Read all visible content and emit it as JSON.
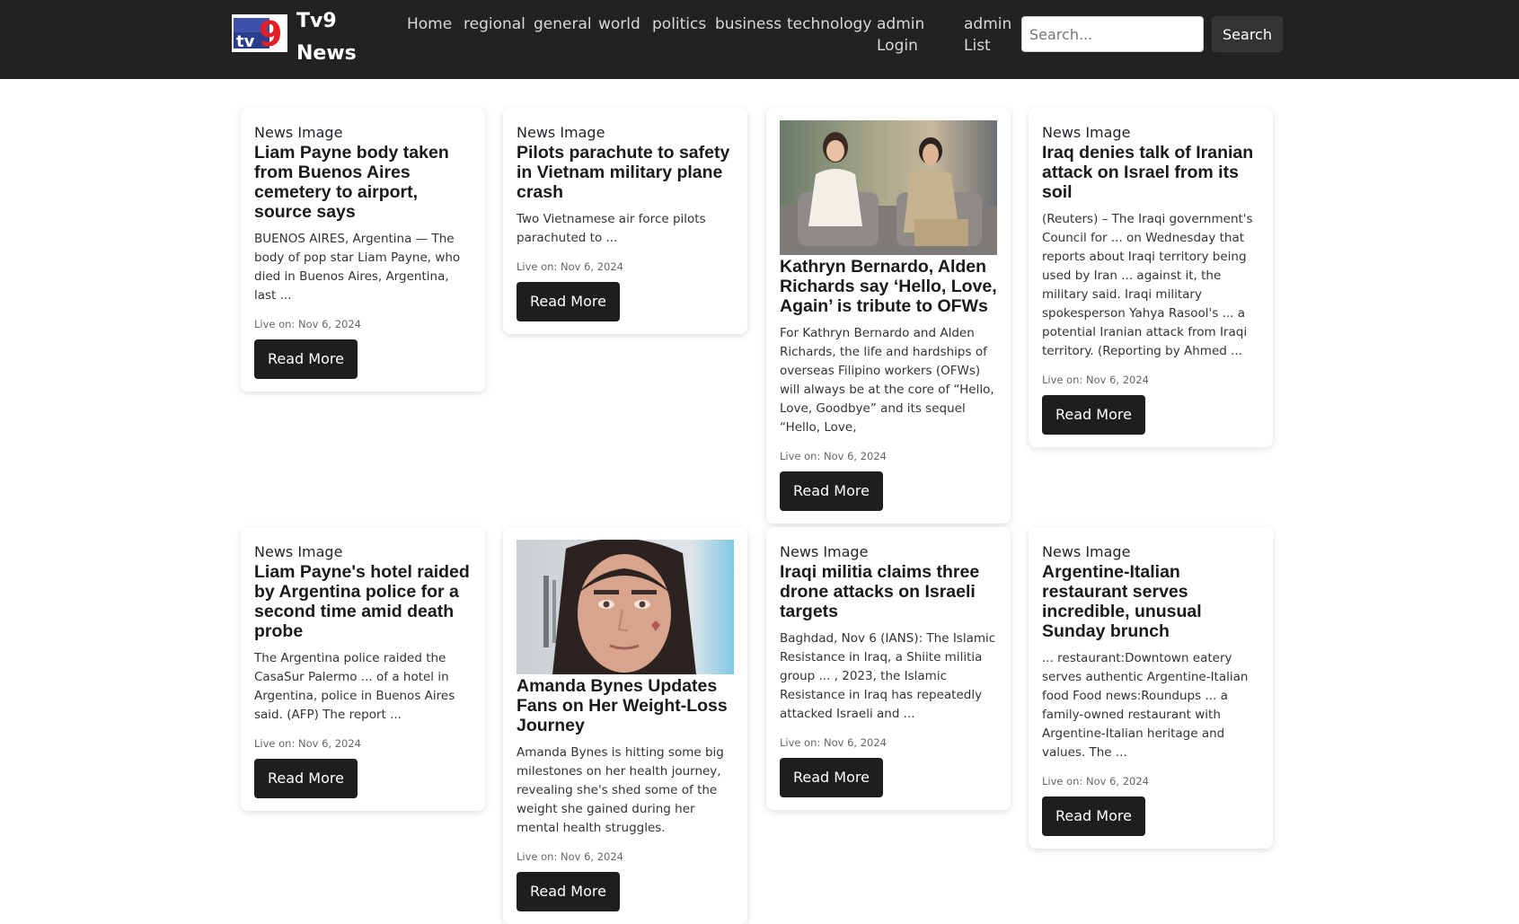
{
  "header": {
    "brand_name": "Tv9 News",
    "nav": [
      "Home",
      "regional",
      "general",
      "world",
      "politics",
      "business",
      "technology",
      "admin Login",
      "admin List"
    ],
    "search_placeholder": "Search...",
    "search_button": "Search"
  },
  "cards": [
    {
      "image_alt": "News Image",
      "title": "Liam Payne body taken from Buenos Aires cemetery to airport, source says",
      "text": "BUENOS AIRES, Argentina — The body of pop star Liam Payne, who died in Buenos Aires, Argentina, last ...",
      "date": "Live on: Nov 6, 2024",
      "button": "Read More"
    },
    {
      "image_alt": "News Image",
      "title": "Pilots parachute to safety in Vietnam military plane crash",
      "text": "Two Vietnamese air force pilots parachuted to ...",
      "date": "Live on: Nov 6, 2024",
      "button": "Read More"
    },
    {
      "image_alt": "",
      "title": "Kathryn Bernardo, Alden Richards say ‘Hello, Love, Again’ is tribute to OFWs",
      "text": "For Kathryn Bernardo and Alden Richards, the life and hardships of overseas Filipino workers (OFWs) will always be at the core of “Hello, Love, Goodbye” and its sequel “Hello, Love,",
      "date": "Live on: Nov 6, 2024",
      "button": "Read More"
    },
    {
      "image_alt": "News Image",
      "title": "Iraq denies talk of Iranian attack on Israel from its soil",
      "text": "(Reuters) – The Iraqi government's Council for ... on Wednesday that reports about Iraqi territory being used by Iran ... against it, the military said. Iraqi military spokesperson Yahya Rasool's ... a potential Iranian attack from Iraqi territory. (Reporting by Ahmed ...",
      "date": "Live on: Nov 6, 2024",
      "button": "Read More"
    },
    {
      "image_alt": "News Image",
      "title": "Liam Payne's hotel raided by Argentina police for a second time amid death probe",
      "text": "The Argentina police raided the CasaSur Palermo ... of a hotel in Argentina, police in Buenos Aires said. (AFP) The report ...",
      "date": "Live on: Nov 6, 2024",
      "button": "Read More"
    },
    {
      "image_alt": "",
      "title": "Amanda Bynes Updates Fans on Her Weight-Loss Journey",
      "text": "Amanda Bynes is hitting some big milestones on her health journey, revealing she's shed some of the weight she gained during her mental health struggles.",
      "date": "Live on: Nov 6, 2024",
      "button": "Read More"
    },
    {
      "image_alt": "News Image",
      "title": "Iraqi militia claims three drone attacks on Israeli targets",
      "text": "Baghdad, Nov 6 (IANS): The Islamic Resistance in Iraq, a Shiite militia group ... , 2023, the Islamic Resistance in Iraq has repeatedly attacked Israeli and ...",
      "date": "Live on: Nov 6, 2024",
      "button": "Read More"
    },
    {
      "image_alt": "News Image",
      "title": "Argentine-Italian restaurant serves incredible, unusual Sunday brunch",
      "text": "... restaurant:Downtown eatery serves authentic Argentine-Italian food Food news:Roundups ... a family-owned restaurant with Argentine-Italian heritage and values. The ...",
      "date": "Live on: Nov 6, 2024",
      "button": "Read More"
    }
  ]
}
